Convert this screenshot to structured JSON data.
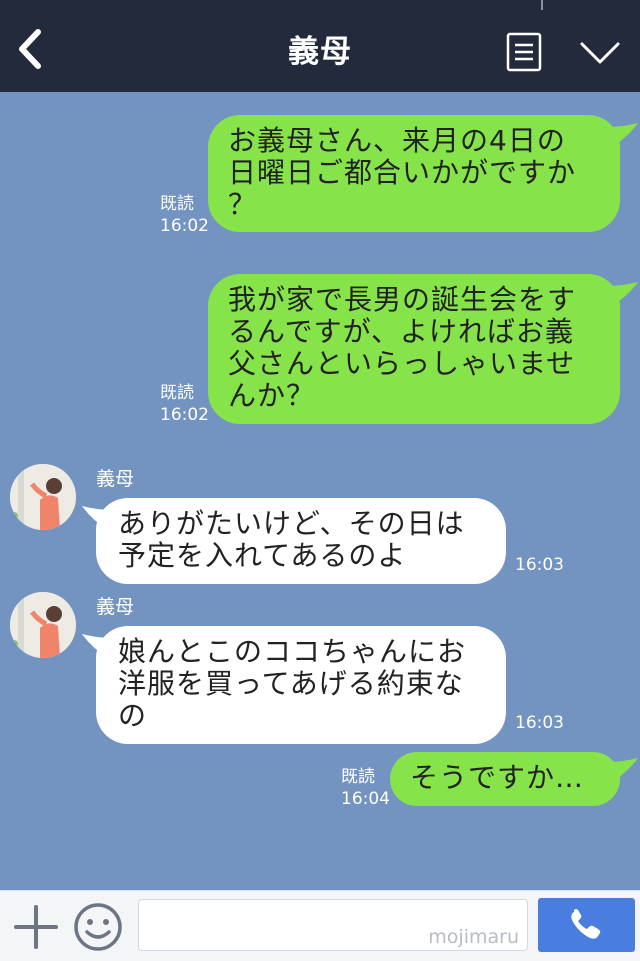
{
  "header": {
    "title": "義母",
    "back_icon": "chevron-left-icon",
    "menu_icon": "list-icon",
    "dropdown_icon": "chevron-down-icon",
    "background": "#232a3c"
  },
  "chat": {
    "background": "#7393c1",
    "outgoing_bubble_color": "#86e44a",
    "incoming_bubble_color": "#ffffff",
    "messages": [
      {
        "direction": "out",
        "lines": [
          "お義母さん、来月の4日の",
          "日曜日ご都合いかがですか",
          "？"
        ],
        "read_label": "既読",
        "time": "16:02"
      },
      {
        "direction": "out",
        "lines": [
          "我が家で長男の誕生会をす",
          "るんですが、よければお義",
          "父さんといらっしゃいませ",
          "んか？"
        ],
        "read_label": "既読",
        "time": "16:02"
      },
      {
        "direction": "in",
        "sender": "義母",
        "lines": [
          "ありがたいけど、その日は",
          "予定を入れてあるのよ"
        ],
        "time": "16:03"
      },
      {
        "direction": "in",
        "sender": "義母",
        "lines": [
          "娘んとこのココちゃんにお",
          "洋服を買ってあげる約束な",
          "の"
        ],
        "time": "16:03"
      },
      {
        "direction": "out",
        "lines": [
          "そうですか…"
        ],
        "read_label": "既読",
        "time": "16:04"
      }
    ]
  },
  "input_bar": {
    "plus_icon": "plus-icon",
    "emoji_icon": "smiley-icon",
    "text_value": "",
    "watermark": "mojimaru",
    "call_icon": "phone-icon",
    "call_button_color": "#4a7de0"
  }
}
